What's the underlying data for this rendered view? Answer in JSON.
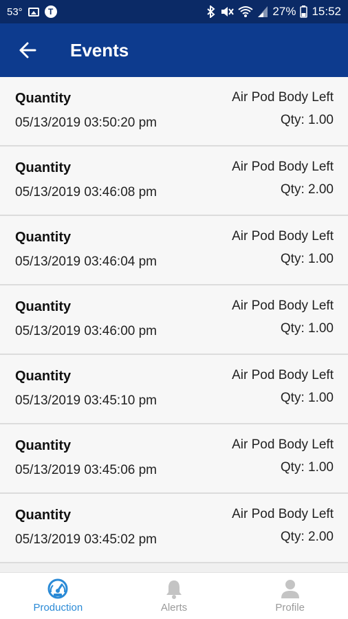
{
  "status_bar": {
    "temperature": "53°",
    "battery": "27%",
    "time": "15:52"
  },
  "app_bar": {
    "title": "Events"
  },
  "events": [
    {
      "title": "Quantity",
      "date": "05/13/2019 03:50:20 pm",
      "product": "Air Pod Body Left",
      "qty": "Qty: 1.00"
    },
    {
      "title": "Quantity",
      "date": "05/13/2019 03:46:08 pm",
      "product": "Air Pod Body Left",
      "qty": "Qty: 2.00"
    },
    {
      "title": "Quantity",
      "date": "05/13/2019 03:46:04 pm",
      "product": "Air Pod Body Left",
      "qty": "Qty: 1.00"
    },
    {
      "title": "Quantity",
      "date": "05/13/2019 03:46:00 pm",
      "product": "Air Pod Body Left",
      "qty": "Qty: 1.00"
    },
    {
      "title": "Quantity",
      "date": "05/13/2019 03:45:10 pm",
      "product": "Air Pod Body Left",
      "qty": "Qty: 1.00"
    },
    {
      "title": "Quantity",
      "date": "05/13/2019 03:45:06 pm",
      "product": "Air Pod Body Left",
      "qty": "Qty: 1.00"
    },
    {
      "title": "Quantity",
      "date": "05/13/2019 03:45:02 pm",
      "product": "Air Pod Body Left",
      "qty": "Qty: 2.00"
    }
  ],
  "bottom_nav": {
    "items": [
      {
        "label": "Production",
        "icon": "speedometer-icon",
        "active": true
      },
      {
        "label": "Alerts",
        "icon": "bell-icon",
        "active": false
      },
      {
        "label": "Profile",
        "icon": "person-icon",
        "active": false
      }
    ]
  },
  "colors": {
    "status_bar": "#0b2a66",
    "app_bar": "#0d3b8e",
    "active_tab": "#2a8ad6",
    "inactive_tab": "#9a9a9a"
  }
}
